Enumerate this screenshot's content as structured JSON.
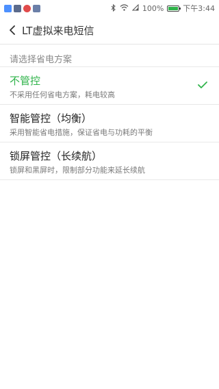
{
  "status_bar": {
    "battery_text": "100%",
    "battery_level": 1.0,
    "time": "下午3:44",
    "notification_icons": [
      {
        "name": "app-icon-blue",
        "color": "#4d90fe"
      },
      {
        "name": "message-icon",
        "color": "#5b6b8c"
      },
      {
        "name": "record-icon",
        "color": "#e04b4b"
      },
      {
        "name": "chat-icon",
        "color": "#6b7fa8"
      }
    ],
    "status_icons": [
      "bluetooth-icon",
      "wifi-icon",
      "signal-icon",
      "battery-icon"
    ]
  },
  "header": {
    "title": "LT虚拟来电短信"
  },
  "section": {
    "label": "请选择省电方案"
  },
  "options": [
    {
      "title": "不管控",
      "desc": "不采用任何省电方案，耗电较高",
      "selected": true
    },
    {
      "title": "智能管控（均衡）",
      "desc": "采用智能省电措施，保证省电与功耗的平衡",
      "selected": false
    },
    {
      "title": "锁屏管控（长续航）",
      "desc": "锁屏和黑屏时，限制部分功能来延长续航",
      "selected": false
    }
  ],
  "colors": {
    "accent": "#2fb34a"
  }
}
